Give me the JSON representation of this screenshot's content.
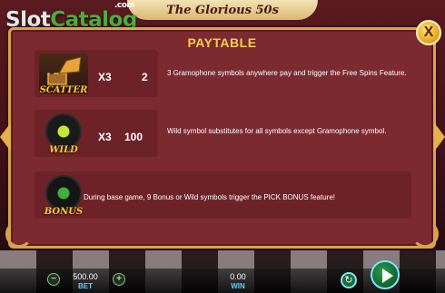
{
  "watermark": {
    "slot": "Slot",
    "catalog": "Catalog",
    "com": ".com"
  },
  "game_title": "The Glorious 50s",
  "paytable": {
    "title": "PAYTABLE",
    "close_label": "X",
    "rows": [
      {
        "symbol_label": "SCATTER",
        "symbol_icon": "gramophone-icon",
        "multiplier": "X3",
        "payout": "2",
        "description": "3 Gramophone symbols anywhere pay and trigger the Free Spins Feature."
      },
      {
        "symbol_label": "WILD",
        "symbol_icon": "vinyl-record-icon",
        "multiplier": "X3",
        "payout": "100",
        "description": "Wild symbol substitutes for all symbols except Gramophone symbol."
      },
      {
        "symbol_label": "BONUS",
        "symbol_icon": "green-record-icon",
        "description": "During base game, 9 Bonus or Wild symbols trigger the PICK BONUS feature!"
      }
    ]
  },
  "bottom_bar": {
    "bet_value": "500.00",
    "bet_label": "BET",
    "win_value": "0.00",
    "win_label": "WIN",
    "minus_label": "−",
    "plus_label": "+"
  },
  "colors": {
    "panel_bg": "#7b2a2f",
    "panel_border": "#d8a44a",
    "title_gold": "#f5d04a",
    "label_blue": "#5fd0ff"
  }
}
